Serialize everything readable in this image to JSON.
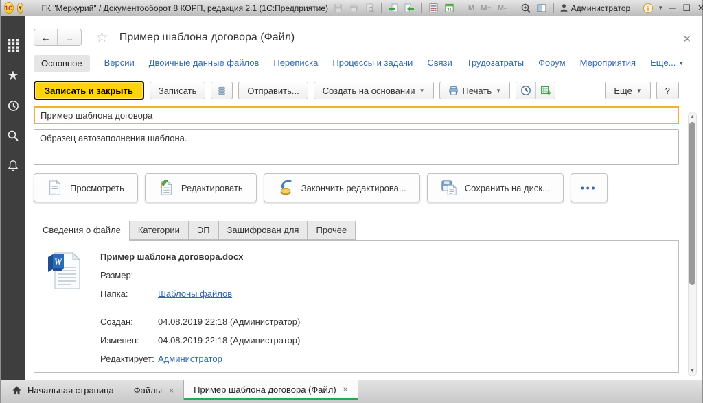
{
  "titlebar": {
    "logo": "1С",
    "app_title": "ГК \"Меркурий\" / Документооборот 8 КОРП, редакция 2.1  (1С:Предприятие)",
    "m1": "M",
    "m2": "M+",
    "m3": "M-",
    "user_name": "Администратор",
    "minimize": "—",
    "maximize": "☐",
    "close": "✕"
  },
  "glyphs": {
    "back": "←",
    "forward": "→",
    "fav_star": "☆",
    "caret_down": "▼",
    "close_x": "×",
    "up": "▲",
    "down": "▼",
    "dots": "•••"
  },
  "form": {
    "title": "Пример шаблона договора (Файл)",
    "nav_links": [
      "Основное",
      "Версии",
      "Двоичные данные файлов",
      "Переписка",
      "Процессы и задачи",
      "Связи",
      "Трудозатраты",
      "Форум",
      "Мероприятия",
      "Еще..."
    ],
    "toolbar": {
      "save_close": "Записать и закрыть",
      "save": "Записать",
      "send": "Отправить...",
      "create_based_on": "Создать на основании",
      "print": "Печать",
      "more": "Еще",
      "help": "?"
    },
    "name_value": "Пример шаблона договора",
    "description_value": "Образец автозаполнения шаблона.",
    "actions": [
      "Просмотреть",
      "Редактировать",
      "Закончить редактирова...",
      "Сохранить на диск..."
    ],
    "tabs": [
      "Сведения о файле",
      "Категории",
      "ЭП",
      "Зашифрован для",
      "Прочее"
    ],
    "file": {
      "filename": "Пример шаблона договора.docx",
      "size_label": "Размер:",
      "size_value": "-",
      "folder_label": "Папка:",
      "folder_value": "Шаблоны файлов",
      "created_label": "Создан:",
      "created_value": "04.08.2019 22:18 (Администратор)",
      "modified_label": "Изменен:",
      "modified_value": "04.08.2019 22:18 (Администратор)",
      "editor_label": "Редактирует:",
      "editor_value": "Администратор"
    },
    "accent_colors": {
      "primary_button": "#ffd40a",
      "focused_field_border": "#eeb32b",
      "active_tab_underline": "#1caf4b",
      "link": "#3067b0"
    }
  },
  "taskbar": {
    "tabs": [
      {
        "label": "Начальная страница"
      },
      {
        "label": "Файлы"
      },
      {
        "label": "Пример шаблона договора (Файл)"
      }
    ]
  }
}
